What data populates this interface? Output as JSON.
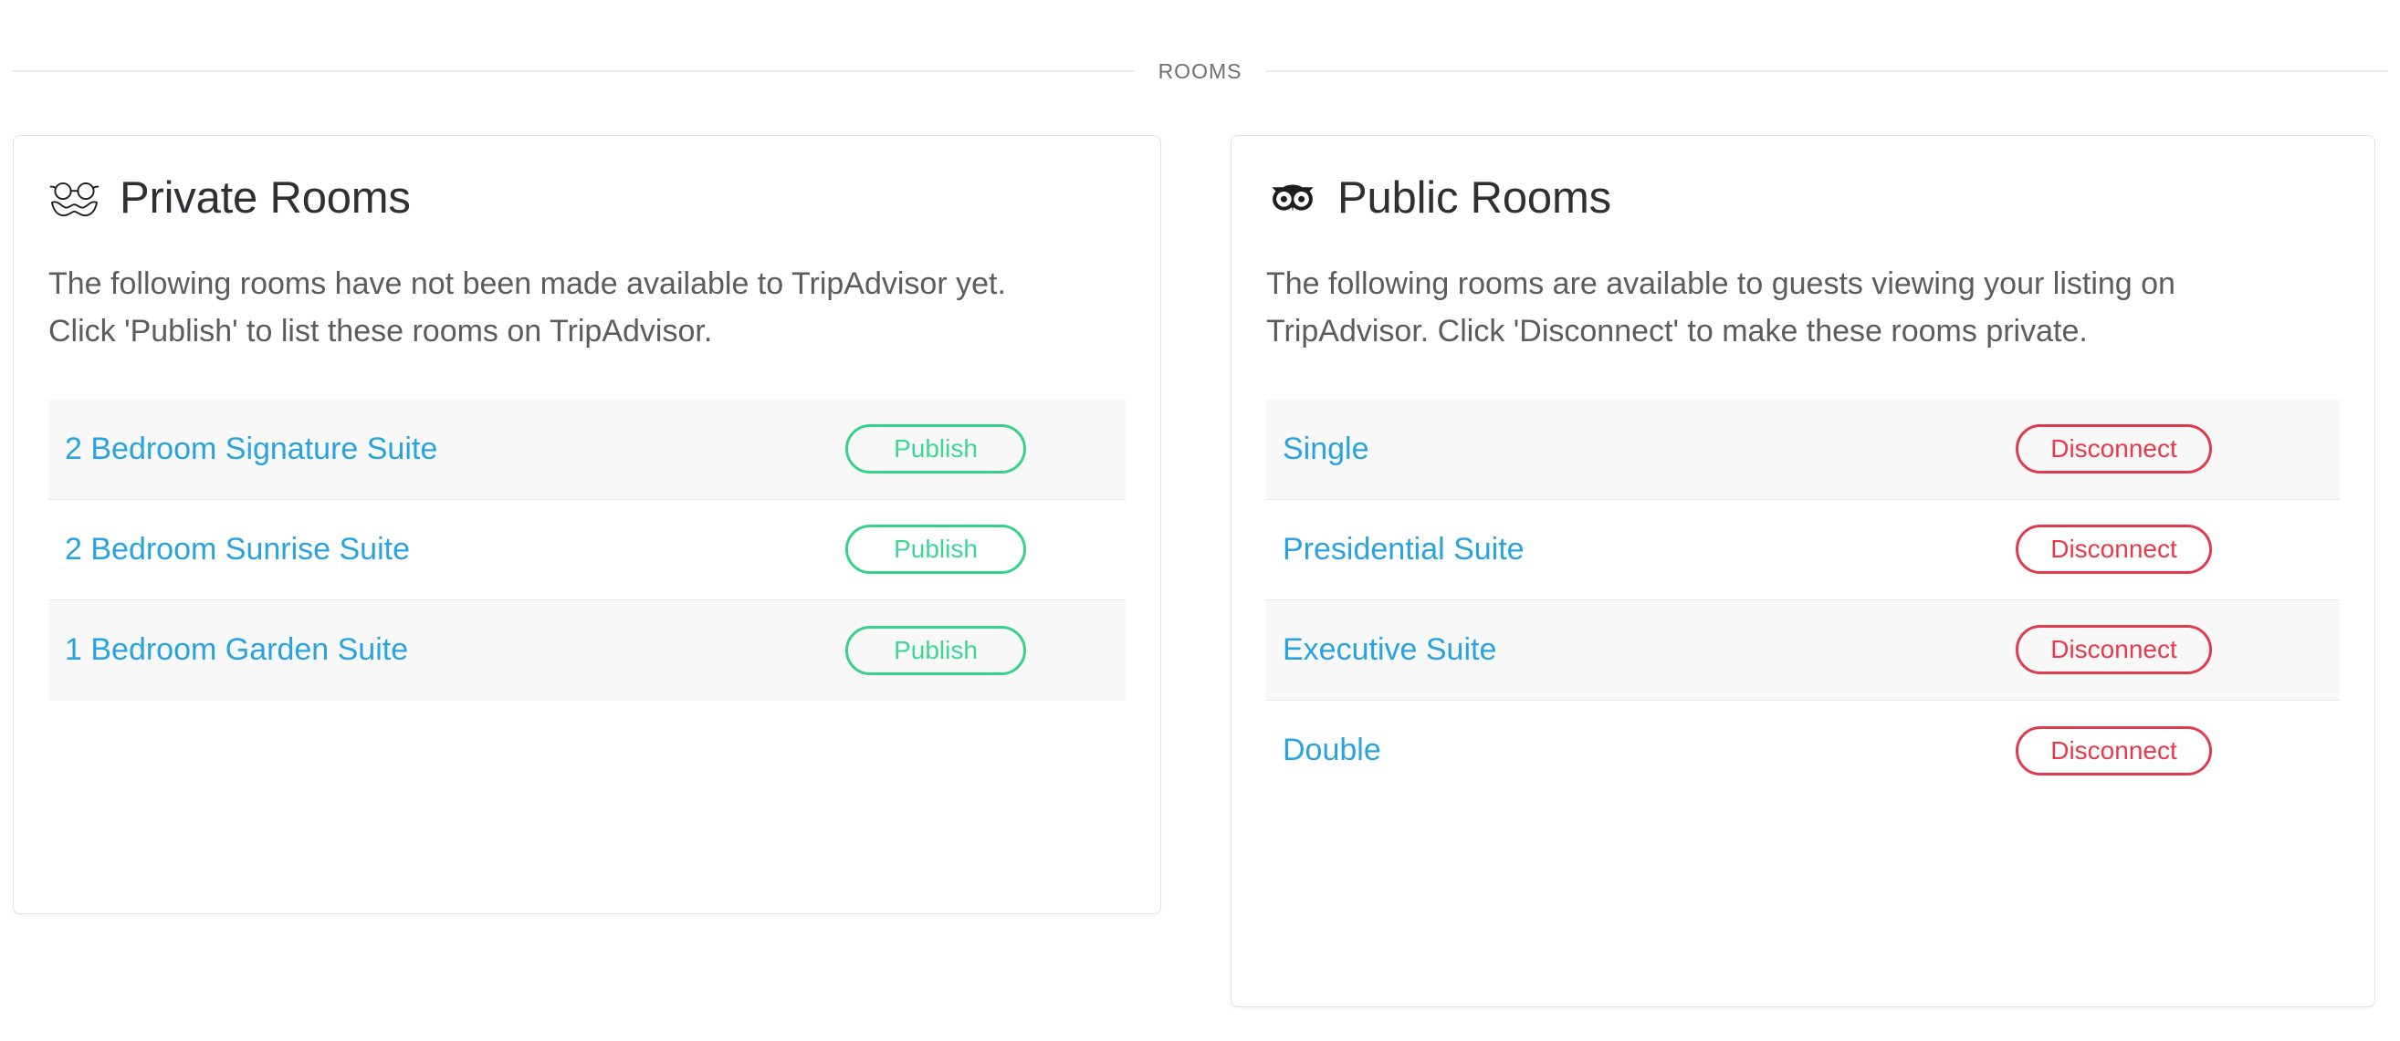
{
  "section": {
    "label": "ROOMS"
  },
  "private_card": {
    "icon": "disguise-incognito-icon",
    "title": "Private Rooms",
    "description": "The following rooms have not been made available to TripAdvisor yet. Click 'Publish' to list these rooms on TripAdvisor.",
    "action_label": "Publish",
    "action_color": "#3ed695",
    "rooms": [
      {
        "name": "2 Bedroom Signature Suite",
        "action": "Publish"
      },
      {
        "name": "2 Bedroom Sunrise Suite",
        "action": "Publish"
      },
      {
        "name": "1 Bedroom Garden Suite",
        "action": "Publish"
      }
    ]
  },
  "public_card": {
    "icon": "tripadvisor-owl-icon",
    "title": "Public Rooms",
    "description": "The following rooms are available to guests viewing your listing on TripAdvisor. Click 'Disconnect' to make these rooms private.",
    "action_label": "Disconnect",
    "action_color": "#e8394b",
    "rooms": [
      {
        "name": "Single",
        "action": "Disconnect"
      },
      {
        "name": "Presidential Suite",
        "action": "Disconnect"
      },
      {
        "name": "Executive Suite",
        "action": "Disconnect"
      },
      {
        "name": "Double",
        "action": "Disconnect"
      }
    ]
  },
  "colors": {
    "link": "#29a3e0",
    "text": "#5c5c5c",
    "heading": "#2f3033",
    "divider": "#ececec",
    "stripe": "#f8f8f8"
  }
}
